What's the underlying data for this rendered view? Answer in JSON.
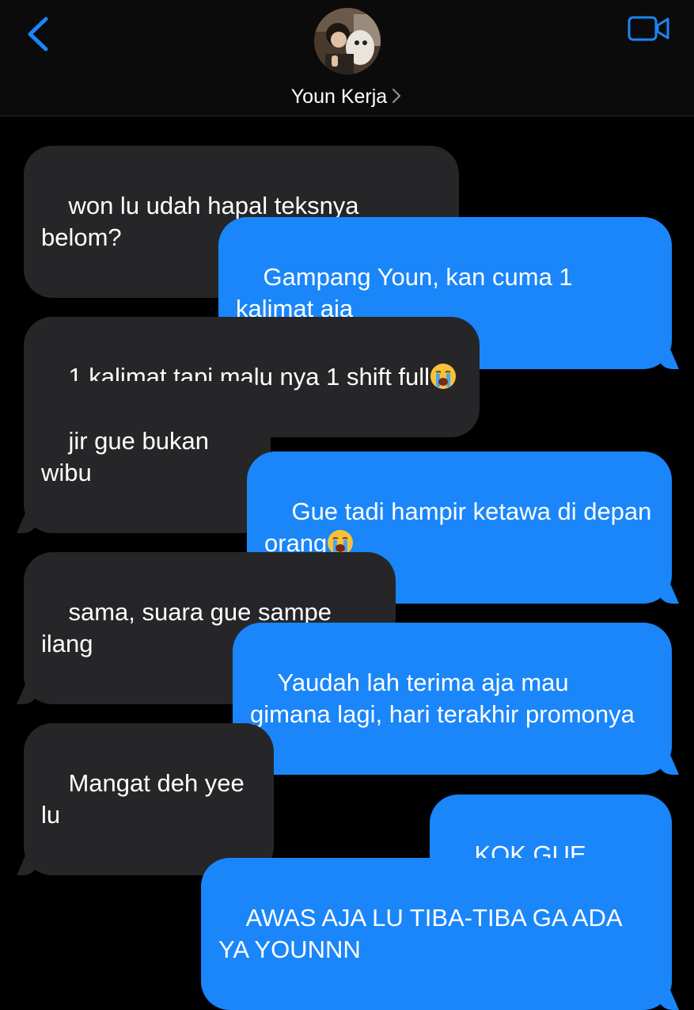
{
  "header": {
    "contact_name": "Youn Kerja",
    "back_icon": "chevron-left-icon",
    "video_icon": "video-camera-icon",
    "accent_color": "#1a86f9"
  },
  "messages": [
    {
      "side": "received",
      "text": "won lu udah hapal teksnya belom?"
    },
    {
      "side": "sent",
      "text": "Gampang Youn, kan cuma 1 kalimat aja"
    },
    {
      "side": "received",
      "text": "1 kalimat tapi malu nya 1 shift full",
      "emoji": "loudly-crying-face"
    },
    {
      "side": "received",
      "text": "jir gue bukan wibu"
    },
    {
      "side": "sent",
      "text": "Gue tadi hampir ketawa di depan orang",
      "emoji": "loudly-crying-face"
    },
    {
      "side": "received",
      "text": "sama, suara gue sampe ilang"
    },
    {
      "side": "sent",
      "text": "Yaudah lah terima aja mau gimana lagi, hari terakhir promonya"
    },
    {
      "side": "received",
      "text": "Mangat deh yee lu"
    },
    {
      "side": "sent",
      "text": "KOK GUE DOANG"
    },
    {
      "side": "sent",
      "text": "AWAS AJA LU TIBA-TIBA GA ADA YA YOUNNN"
    }
  ],
  "colors": {
    "background": "#000000",
    "received_bubble": "#262628",
    "sent_bubble": "#1a86f9"
  }
}
